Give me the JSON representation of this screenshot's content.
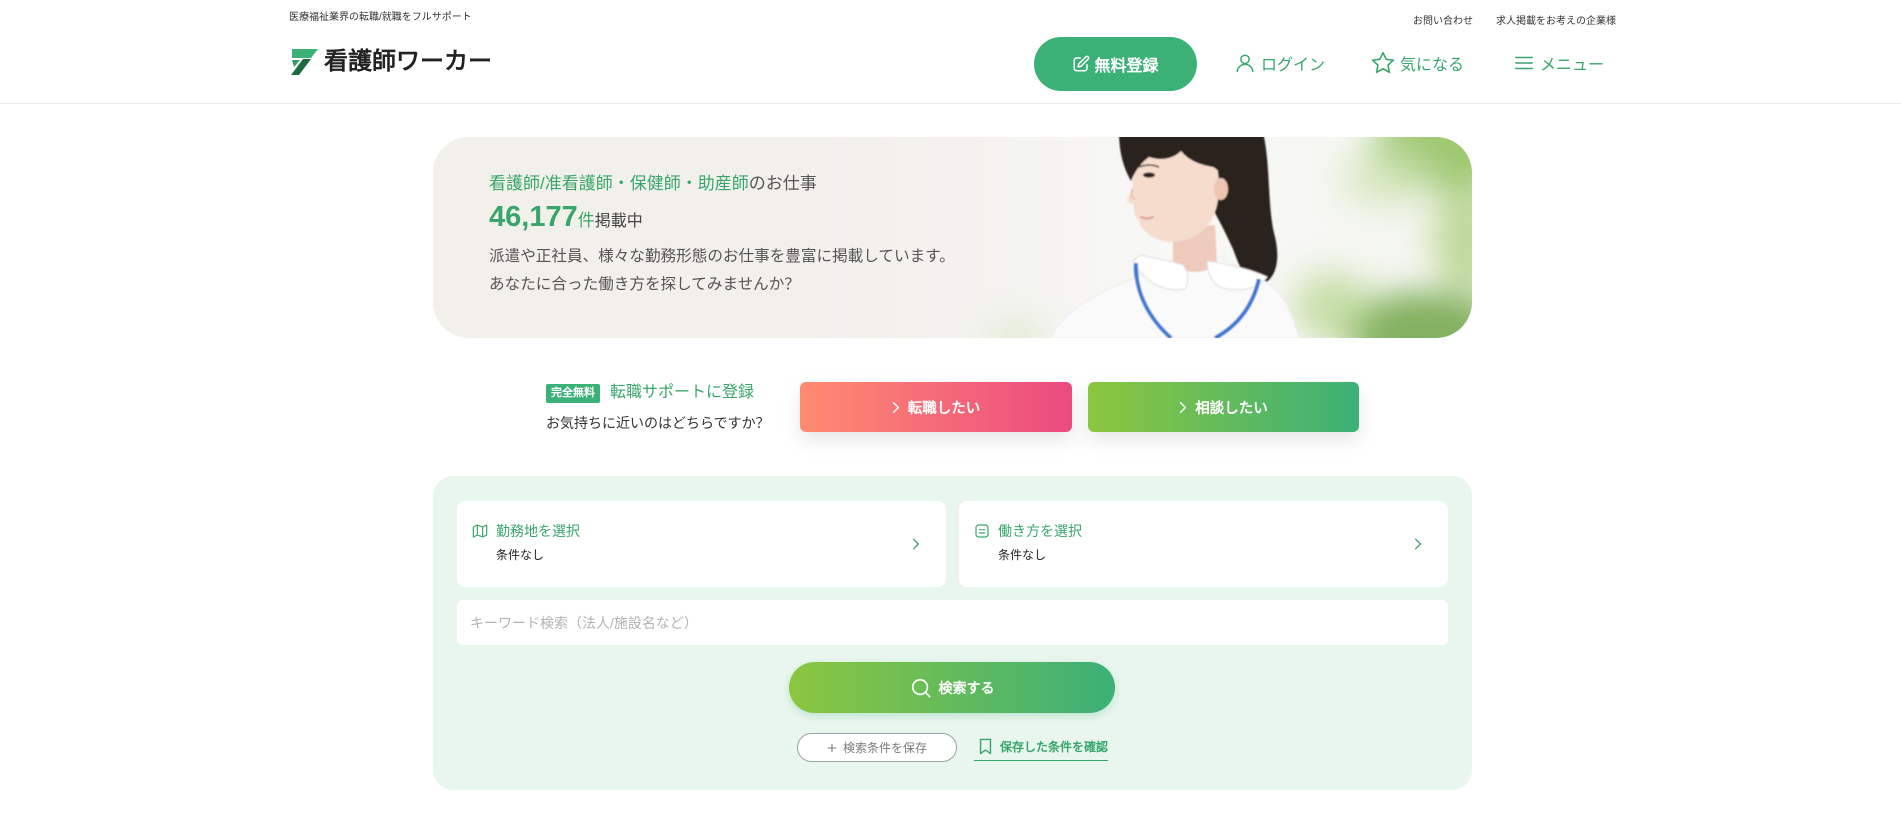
{
  "header": {
    "tagline": "医療福祉業界の転職/就職をフルサポート",
    "logo_text": "看護師ワーカー",
    "logo_icon": "logo-mark-icon",
    "top_links": [
      "お問い合わせ",
      "求人掲載をお考えの企業様"
    ],
    "nav": {
      "register": {
        "label": "無料登録",
        "icon": "edit-icon"
      },
      "login": {
        "label": "ログイン",
        "icon": "user-icon"
      },
      "favorites": {
        "label": "気になる",
        "icon": "star-icon"
      },
      "menu": {
        "label": "メニュー",
        "icon": "hamburger-menu-icon"
      }
    }
  },
  "hero": {
    "occupations": "看護師/准看護師・保健師・助産師",
    "occupations_suffix": "のお仕事",
    "job_count": "46,177",
    "count_unit": "件",
    "count_suffix": "掲載中",
    "description_lines": [
      "派遣や正社員、様々な勤務形態のお仕事を豊富に掲載しています。",
      "あなたに合った働き方を探してみませんか？"
    ]
  },
  "register_cta": {
    "badge": "完全無料",
    "title": "転職サポートに登録",
    "question": "お気持ちに近いのはどちらですか？",
    "buttons": [
      {
        "label": "転職したい",
        "icon": "chevron-right-icon"
      },
      {
        "label": "相談したい",
        "icon": "chevron-right-icon"
      }
    ]
  },
  "search": {
    "location": {
      "label": "勤務地を選択",
      "value": "条件なし",
      "icon": "map-icon"
    },
    "work_style": {
      "label": "働き方を選択",
      "value": "条件なし",
      "icon": "clipboard-icon"
    },
    "keyword": {
      "value": "",
      "placeholder": "キーワード検索（法人/施設名など）"
    },
    "submit": {
      "label": "検索する",
      "icon": "search-icon"
    },
    "save_conditions": {
      "label": "検索条件を保存",
      "icon": "plus-icon"
    },
    "saved_conditions": {
      "label": "保存した条件を確認",
      "icon": "bookmark-icon"
    }
  },
  "colors": {
    "primary": "#3bb077",
    "text_green": "#38a66c",
    "hero_bg": "#f2f0eb",
    "panel_bg": "#e9f6ee",
    "cta_change_start": "#ff8b70",
    "cta_change_end": "#eb4b80",
    "cta_consult_start": "#8cc63f",
    "cta_consult_end": "#3bb077",
    "lanyard_blue": "#3a78d2"
  }
}
